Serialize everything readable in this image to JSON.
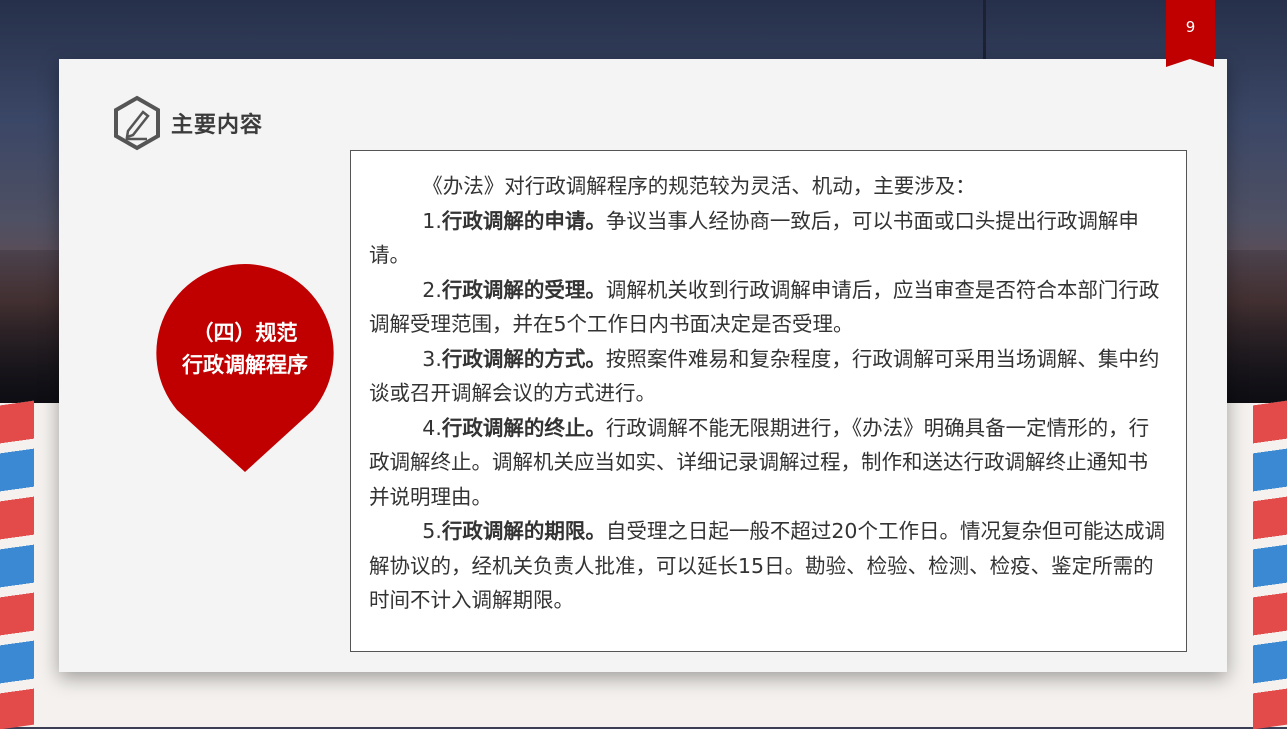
{
  "page_number": "9",
  "heading": {
    "title": "主要内容",
    "icon": "pencil-hexagon-icon"
  },
  "section_badge": {
    "line1": "（四）规范",
    "line2": "行政调解程序",
    "color": "#c00000"
  },
  "content": {
    "intro": "《办法》对行政调解程序的规范较为灵活、机动，主要涉及：",
    "items": [
      {
        "number": "1.",
        "title": "行政调解的申请。",
        "text": "争议当事人经协商一致后，可以书面或口头提出行政调解申请。"
      },
      {
        "number": "2.",
        "title": "行政调解的受理。",
        "text": "调解机关收到行政调解申请后，应当审查是否符合本部门行政调解受理范围，并在5个工作日内书面决定是否受理。"
      },
      {
        "number": "3.",
        "title": "行政调解的方式。",
        "text": "按照案件难易和复杂程度，行政调解可采用当场调解、集中约谈或召开调解会议的方式进行。"
      },
      {
        "number": "4.",
        "title": "行政调解的终止。",
        "text": "行政调解不能无限期进行，《办法》明确具备一定情形的，行政调解终止。调解机关应当如实、详细记录调解过程，制作和送达行政调解终止通知书并说明理由。"
      },
      {
        "number": "5.",
        "title": "行政调解的期限。",
        "text": "自受理之日起一般不超过20个工作日。情况复杂但可能达成调解协议的，经机关负责人批准，可以延长15日。勘验、检验、检测、检疫、鉴定所需的时间不计入调解期限。"
      }
    ]
  },
  "colors": {
    "accent": "#c00000",
    "card": "#f5f4f5",
    "stripe_red": "#e34b4b",
    "stripe_blue": "#3a89d2"
  }
}
